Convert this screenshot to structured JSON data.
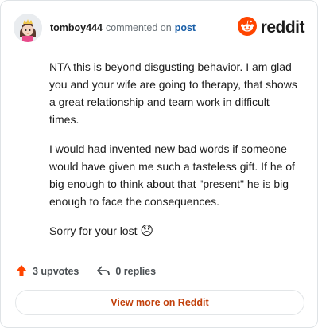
{
  "header": {
    "username": "tomboy444",
    "action_text": "commented on",
    "link_text": "post",
    "brand_name": "reddit"
  },
  "comment": {
    "paragraphs": [
      "NTA this is beyond disgusting behavior. I am glad you and your wife are going to therapy, that shows a great relationship and team work in difficult times.",
      "I would had invented new bad words if someone would have given me such a tasteless gift. If he of big enough to think about that \"present\" he is big enough to face the consequences.",
      "Sorry for your lost"
    ],
    "emoji": "😞"
  },
  "actions": {
    "upvotes_label": "3 upvotes",
    "replies_label": "0 replies"
  },
  "footer": {
    "view_more_label": "View more on Reddit"
  },
  "colors": {
    "reddit_orange": "#ff4500",
    "link_blue": "#1a5fa8",
    "view_more_text": "#c2410c"
  },
  "icons": {
    "avatar": "user-avatar-icon",
    "brand": "reddit-logo-icon",
    "upvote": "upvote-arrow-icon",
    "reply": "reply-arrow-icon"
  }
}
